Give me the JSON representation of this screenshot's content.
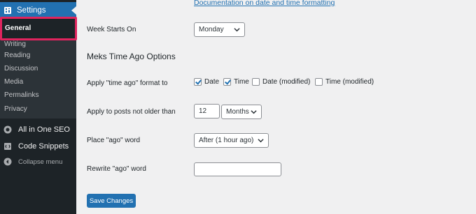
{
  "sidebar": {
    "settings_label": "Settings",
    "submenu": {
      "current": "General",
      "items": [
        "Writing",
        "Reading",
        "Discussion",
        "Media",
        "Permalinks",
        "Privacy"
      ]
    },
    "menu_items": [
      {
        "label": "All in One SEO",
        "icon": "aioseo-icon"
      },
      {
        "label": "Code Snippets",
        "icon": "code-snippets-icon"
      },
      {
        "label": "Collapse menu",
        "icon": "collapse-icon"
      }
    ]
  },
  "main": {
    "doc_link": "Documentation on date and time formatting",
    "week_starts_on": {
      "label": "Week Starts On",
      "value": "Monday"
    },
    "section_title": "Meks Time Ago Options",
    "apply_format": {
      "label": "Apply \"time ago\" format to",
      "options": [
        {
          "label": "Date",
          "checked": true
        },
        {
          "label": "Time",
          "checked": true
        },
        {
          "label": "Date (modified)",
          "checked": false
        },
        {
          "label": "Time (modified)",
          "checked": false
        }
      ]
    },
    "not_older_than": {
      "label": "Apply to posts not older than",
      "number": "12",
      "unit": "Months"
    },
    "place_ago": {
      "label": "Place \"ago\" word",
      "value": "After (1 hour ago)"
    },
    "rewrite_ago": {
      "label": "Rewrite \"ago\" word",
      "value": ""
    },
    "save_label": "Save Changes"
  },
  "colors": {
    "accent": "#2271b1",
    "sidebar_bg": "#1d2327",
    "submenu_bg": "#2c3338",
    "highlight": "#e0245e"
  }
}
